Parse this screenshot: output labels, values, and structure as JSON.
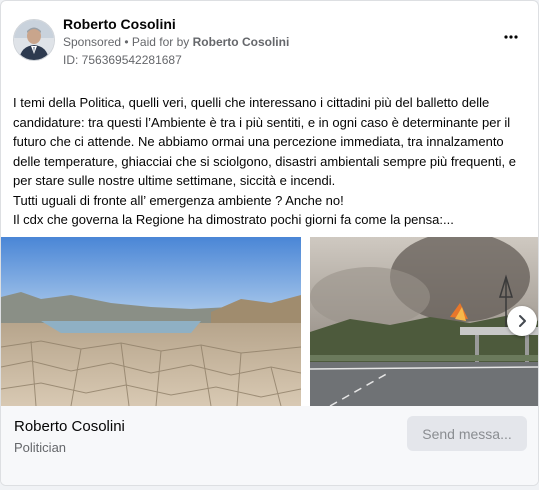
{
  "post": {
    "author": "Roberto Cosolini",
    "sponsored_label": "Sponsored",
    "separator": " • ",
    "paid_for_label": "Paid for by ",
    "paid_for_name": "Roberto Cosolini",
    "id_label": "ID: 756369542281687",
    "more_icon": "more-horizontal-icon",
    "text": "I temi della Politica, quelli veri, quelli che interessano i cittadini più del balletto delle candidature: tra questi l’Ambiente è tra i più sentiti, e in ogni caso è determinante per il futuro che ci attende. Ne abbiamo ormai una percezione immediata, tra innalzamento delle temperature, ghiacciai che si sciolgono, disastri ambientali sempre più frequenti, e per stare sulle nostre ultime settimane, siccità e incendi.\nTutti uguali di fronte all’ emergenza ambiente ? Anche no!\nIl cdx che governa la Regione ha dimostrato pochi giorni fa come la pensa:..."
  },
  "footer": {
    "page_name": "Roberto Cosolini",
    "category": "Politician",
    "button_label": "Send messa..."
  },
  "icons": {
    "next": "chevron-right-icon"
  }
}
